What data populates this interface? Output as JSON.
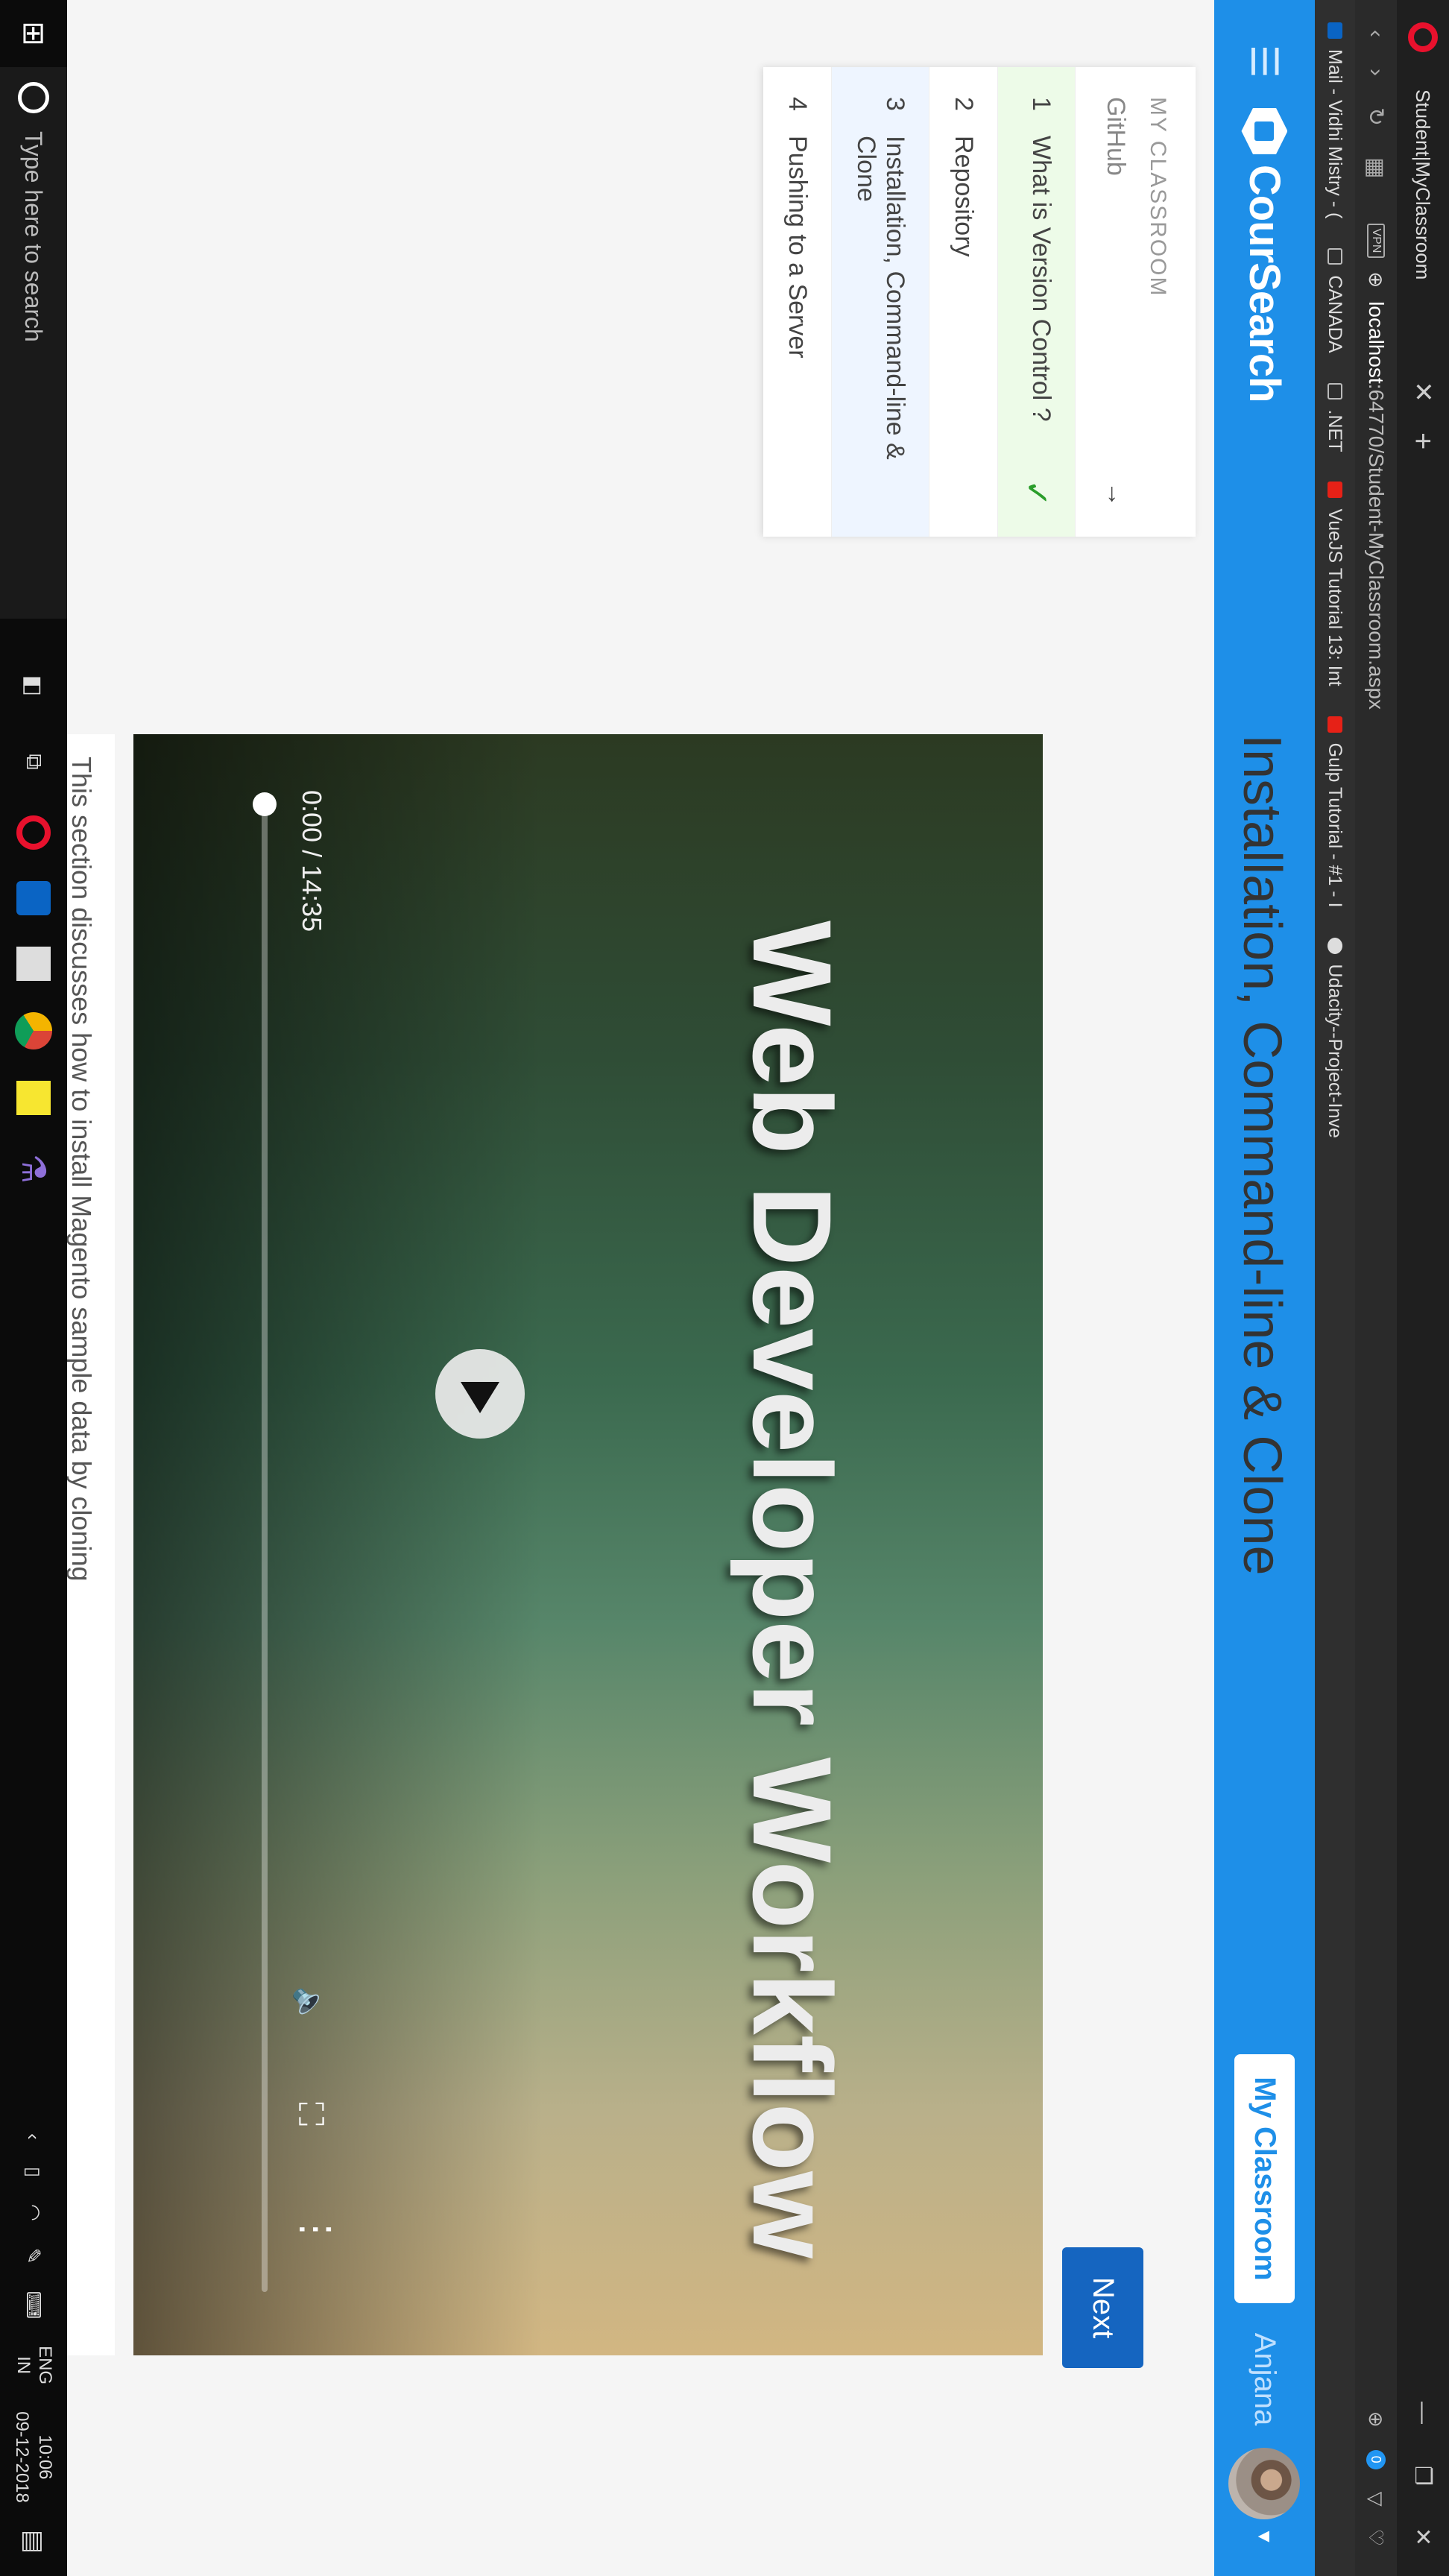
{
  "browser": {
    "tab_title": "Student|MyClassroom",
    "tab_close": "✕",
    "new_tab": "+",
    "url_vpn": "VPN",
    "url_host": "localhost",
    "url_path": ":64770/Student-MyClassroom.aspx",
    "adblock_count": "0",
    "bookmarks": [
      {
        "label": "Mail - Vidhi Mistry - (",
        "icon": "outlook-icon"
      },
      {
        "label": "CANADA",
        "icon": "folder-icon"
      },
      {
        "label": ".NET",
        "icon": "folder-icon"
      },
      {
        "label": "VueJS Tutorial 13: Int",
        "icon": "youtube-icon"
      },
      {
        "label": "Gulp Tutorial - #1 - I",
        "icon": "youtube-icon"
      },
      {
        "label": "Udacity--Project-Inve",
        "icon": "github-icon"
      }
    ]
  },
  "header": {
    "brand": "CourSearch",
    "my_classroom": "My Classroom",
    "username": "Anjana"
  },
  "sidebar": {
    "heading": "MY CLASSROOM",
    "course": "GitHub",
    "items": [
      {
        "num": "1",
        "label": "What is Version Control ?",
        "state": "done"
      },
      {
        "num": "2",
        "label": "Repository",
        "state": "normal"
      },
      {
        "num": "3",
        "label": "Installation, Command-line & Clone",
        "state": "active"
      },
      {
        "num": "4",
        "label": "Pushing to a Server",
        "state": "normal"
      }
    ]
  },
  "main": {
    "title": "Installation, Command-line & Clone",
    "next_label": "Next",
    "video": {
      "overlay_title": "Web Developer Workflow",
      "timecode": "0:00 / 14:35",
      "progress": 0
    },
    "description": "This section discusses how to install Magento sample data by cloning"
  },
  "taskbar": {
    "search_placeholder": "Type here to search",
    "lang_line1": "ENG",
    "lang_line2": "IN",
    "time": "10:06",
    "date": "09-12-2018"
  },
  "colors": {
    "header_blue": "#1e8fe8",
    "next_blue": "#1565c0",
    "done_green": "#edfbe8",
    "active_blue": "#eef5ff"
  }
}
